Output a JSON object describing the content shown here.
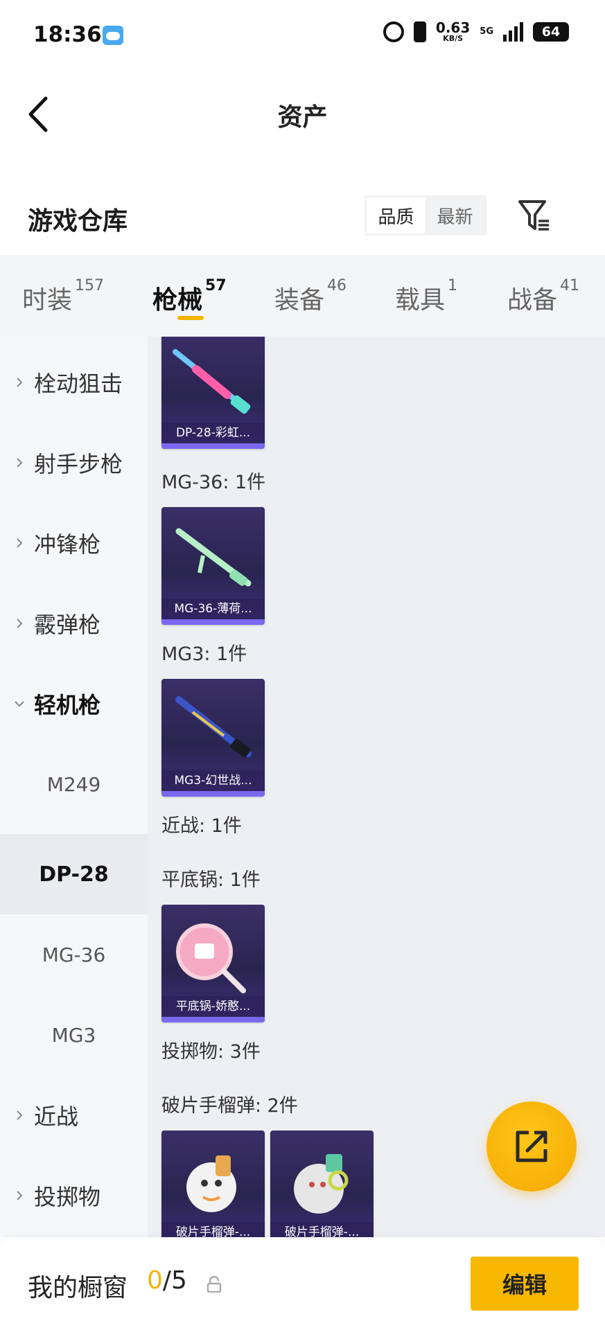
{
  "status_bar": {
    "time": "18:36",
    "speed_value": "0.63",
    "speed_unit": "KB/S",
    "network": "5G",
    "battery": "64"
  },
  "header": {
    "title": "资产"
  },
  "warehouse": {
    "title": "游戏仓库",
    "sort_options": [
      "品质",
      "最新"
    ],
    "active_sort": "品质"
  },
  "tabs": [
    {
      "label": "时装",
      "count": "157"
    },
    {
      "label": "枪械",
      "count": "57",
      "active": true
    },
    {
      "label": "装备",
      "count": "46"
    },
    {
      "label": "载具",
      "count": "1"
    },
    {
      "label": "战备",
      "count": "41"
    }
  ],
  "sidebar": {
    "categories": [
      "栓动狙击",
      "射手步枪",
      "冲锋枪",
      "霰弹枪",
      "轻机枪",
      "近战",
      "投掷物"
    ],
    "expanded": "轻机枪",
    "subitems": [
      "M249",
      "DP-28",
      "MG-36",
      "MG3"
    ],
    "active_sub": "DP-28"
  },
  "content": {
    "cards": [
      {
        "caption": "DP-28-彩虹..."
      },
      {
        "caption": "MG-36-薄荷..."
      },
      {
        "caption": "MG3-幻世战..."
      },
      {
        "caption": "平底锅-娇憨..."
      },
      {
        "caption": "破片手榴弹-..."
      },
      {
        "caption": "破片手榴弹-..."
      }
    ],
    "sections": [
      "MG-36: 1件",
      "MG3: 1件",
      "近战: 1件",
      "平底锅: 1件",
      "投掷物: 3件",
      "破片手榴弹: 2件"
    ]
  },
  "bottom": {
    "showcase_label": "我的橱窗",
    "showcase_current": "0",
    "showcase_sep_total": "/5",
    "edit_label": "编辑"
  },
  "colors": {
    "accent": "#f5b400",
    "card_bg": "#2a2450",
    "card_bar": "#7b68ee"
  }
}
